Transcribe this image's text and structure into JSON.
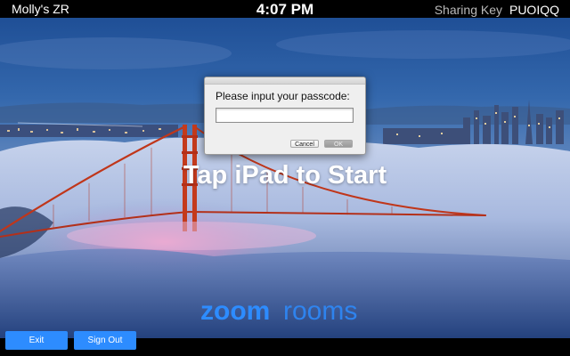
{
  "topbar": {
    "room_name": "Molly's ZR",
    "time": "4:07 PM",
    "sharing_key_label": "Sharing Key",
    "sharing_key_value": "PUOIQQ"
  },
  "main": {
    "headline": "Tap iPad to Start",
    "logo_zoom": "zoom",
    "logo_rooms": "rooms"
  },
  "dialog": {
    "prompt": "Please input your passcode:",
    "input_value": "",
    "cancel_label": "Cancel",
    "ok_label": "OK"
  },
  "footer": {
    "exit_label": "Exit",
    "sign_out_label": "Sign Out"
  },
  "colors": {
    "accent_blue": "#2d8cff",
    "bridge_red": "#c0361a",
    "sky_blue": "#2f5fa3"
  }
}
